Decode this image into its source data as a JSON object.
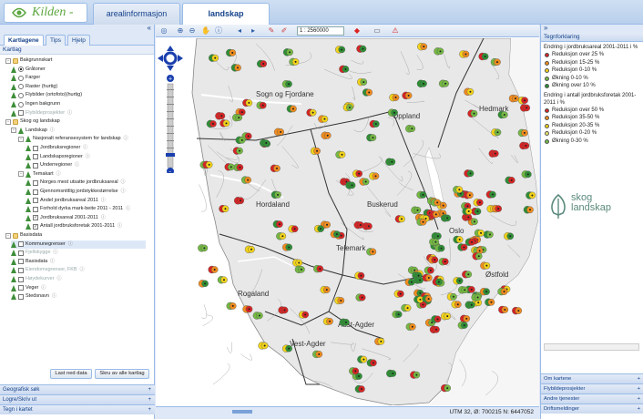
{
  "app": {
    "logo_text": "Kilden - til",
    "tabs": [
      {
        "label": "arealinformasjon",
        "active": false
      },
      {
        "label": "landskap",
        "active": true
      }
    ]
  },
  "left_panel": {
    "collapse_icon": "«",
    "tabs": [
      {
        "label": "Kartlagene",
        "active": true
      },
      {
        "label": "Tips",
        "active": false
      },
      {
        "label": "Hjelp",
        "active": false
      }
    ],
    "section_title": "Kartlag",
    "tree": [
      {
        "label": "Bakgrunnskart",
        "type": "folder"
      },
      {
        "label": "Gråtoner",
        "type": "radio",
        "checked": true
      },
      {
        "label": "Farger",
        "type": "radio",
        "checked": false
      },
      {
        "label": "Raster (hurtig)",
        "type": "radio",
        "checked": false
      },
      {
        "label": "Flybilder (ortofoto)(hurtig)",
        "type": "radio",
        "checked": false
      },
      {
        "label": "Ingen bakgrunn",
        "type": "radio",
        "checked": false
      },
      {
        "label": "Flybildeprosjekter",
        "type": "check",
        "checked": false,
        "muted": true
      },
      {
        "label": "Skog og landskap",
        "type": "folder"
      },
      {
        "label": "Landskap",
        "type": "tree"
      },
      {
        "label": "Nasjonalt referansesystem for landskap",
        "type": "tree"
      },
      {
        "label": "Jordbruksregioner",
        "type": "check",
        "checked": false
      },
      {
        "label": "Landskapsregioner",
        "type": "check",
        "checked": false
      },
      {
        "label": "Underregioner",
        "type": "check",
        "checked": false
      },
      {
        "label": "Temakart",
        "type": "tree"
      },
      {
        "label": "Norges mest utsatte jordbruksareal",
        "type": "check",
        "checked": false
      },
      {
        "label": "Gjennomsnittlig jordstykkestørrelse",
        "type": "check",
        "checked": false
      },
      {
        "label": "Andel jordbruksareal 2011",
        "type": "check",
        "checked": false
      },
      {
        "label": "Forhold dyrka mark-beite 2011 - 2011",
        "type": "check",
        "checked": false
      },
      {
        "label": "Jordbruksareal 2001-2011",
        "type": "check",
        "checked": true
      },
      {
        "label": "Antall jordbruksforetak 2001-2011",
        "type": "check",
        "checked": true
      },
      {
        "label": "Basisdata",
        "type": "folder"
      },
      {
        "label": "Kommunegrenser",
        "type": "check",
        "checked": false,
        "selected": true
      },
      {
        "label": "Fjellskygge",
        "type": "check",
        "checked": false,
        "muted": true
      },
      {
        "label": "Basisdata",
        "type": "check",
        "checked": false
      },
      {
        "label": "Eiendomsgrenser, FKB",
        "type": "check",
        "checked": false,
        "muted": true
      },
      {
        "label": "Høydekurver",
        "type": "check",
        "checked": false,
        "muted": true
      },
      {
        "label": "Veger",
        "type": "check",
        "checked": false
      },
      {
        "label": "Stedsnavn",
        "type": "check",
        "checked": false
      }
    ],
    "buttons": {
      "load_data": "Last ned data",
      "print_all": "Skru av alle kartlag"
    },
    "accordions": [
      "Geografisk søk",
      "Logre/Skriv ut",
      "Tegn i kartet"
    ]
  },
  "toolbar": {
    "scale": "1 : 2560000"
  },
  "map": {
    "labels": [
      "Sogn og Fjordane",
      "Oppland",
      "Hedmark",
      "Hordaland",
      "Buskerud",
      "Telemark",
      "Østfold",
      "Rogaland",
      "Aust-Agder",
      "Vest-Agder",
      "Oslo"
    ]
  },
  "status": {
    "coordinates": "UTM 32, Ø: 700215 N: 6447052"
  },
  "right_panel": {
    "title": "Tegnforklaring",
    "legend_1_title": "Endring i jordbruksareal 2001-2011 i %",
    "legend_1": [
      {
        "label": "Reduksjon over 25 %",
        "color": "#d62424"
      },
      {
        "label": "Reduksjon 15-25 %",
        "color": "#f08c1e"
      },
      {
        "label": "Reduksjon 0-10 %",
        "color": "#f3d31a"
      },
      {
        "label": "Økning 0-10 %",
        "color": "#74b843"
      },
      {
        "label": "Økning over 10 %",
        "color": "#2f8f35"
      }
    ],
    "legend_2_title": "Endring i antall jordbruksforetak 2001-2011 i %",
    "legend_2": [
      {
        "label": "Reduksjon over 50 %",
        "color": "#d62424"
      },
      {
        "label": "Reduksjon 35-50 %",
        "color": "#f08c1e"
      },
      {
        "label": "Reduksjon 20-35 %",
        "color": "#f3d31a"
      },
      {
        "label": "Reduksjon 0-20 %",
        "color": "#e9e26a"
      },
      {
        "label": "Økning 0-30 %",
        "color": "#74b843"
      }
    ],
    "logo_line1": "skog",
    "logo_line2": "landskap",
    "accordions": [
      "Om kartene",
      "Flybildeprosjekter",
      "Andre tjenester",
      "Driftsmeldinger"
    ]
  }
}
